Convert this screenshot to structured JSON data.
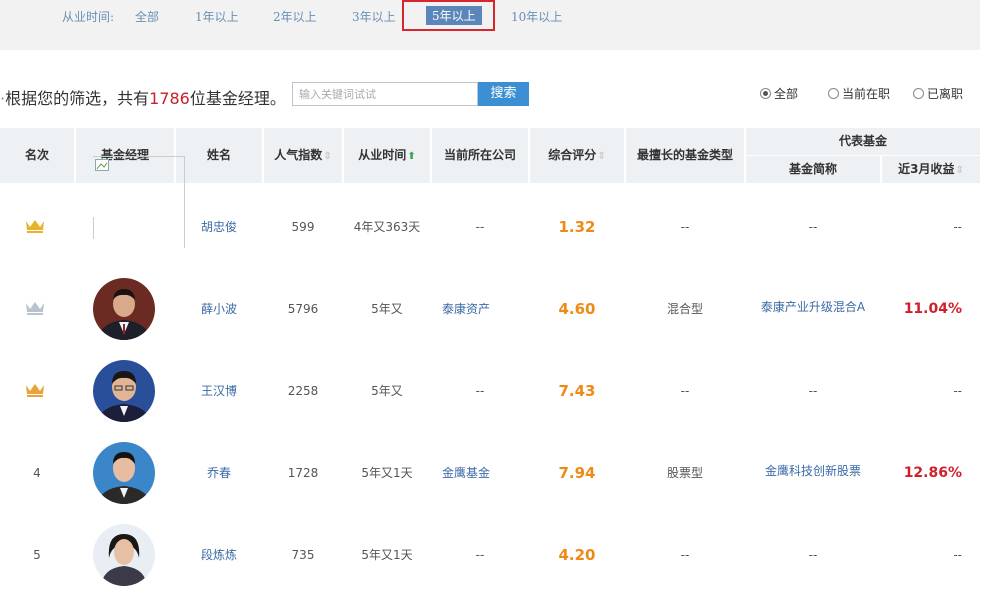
{
  "filter": {
    "label": "从业时间:",
    "options": [
      "全部",
      "1年以上",
      "2年以上",
      "3年以上",
      "5年以上",
      "10年以上"
    ],
    "selected": "5年以上"
  },
  "search": {
    "summary_prefix": "根据您的筛选，共有",
    "count": "1786",
    "summary_suffix": "位基金经理。",
    "placeholder": "输入关键词试试",
    "button": "搜索",
    "radios": [
      "全部",
      "当前在职",
      "已离职"
    ],
    "radio_selected": "全部"
  },
  "table": {
    "headers": {
      "rank": "名次",
      "manager": "基金经理",
      "name": "姓名",
      "popularity": "人气指数",
      "tenure": "从业时间",
      "company": "当前所在公司",
      "score": "综合评分",
      "best_type": "最擅长的基金类型",
      "rep_fund": "代表基金",
      "fund_short": "基金简称",
      "return_3m": "近3月收益"
    },
    "rows": [
      {
        "rank": "",
        "rank_icon": "gold-crown-icon",
        "name": "胡忠俊",
        "popularity": "599",
        "tenure": "4年又363天",
        "company": "--",
        "score": "1.32",
        "best_type": "--",
        "fund": "--",
        "ret": "--"
      },
      {
        "rank": "",
        "rank_icon": "silver-crown-icon",
        "name": "薛小波",
        "popularity": "5796",
        "tenure": "5年又",
        "company": "泰康资产",
        "score": "4.60",
        "best_type": "混合型",
        "fund": "泰康产业升级混合A",
        "ret": "11.04%"
      },
      {
        "rank": "",
        "rank_icon": "bronze-crown-icon",
        "name": "王汉博",
        "popularity": "2258",
        "tenure": "5年又",
        "company": "--",
        "score": "7.43",
        "best_type": "--",
        "fund": "--",
        "ret": "--"
      },
      {
        "rank": "4",
        "rank_icon": "",
        "name": "乔春",
        "popularity": "1728",
        "tenure": "5年又1天",
        "company": "金鹰基金",
        "score": "7.94",
        "best_type": "股票型",
        "fund": "金鹰科技创新股票",
        "ret": "12.86%"
      },
      {
        "rank": "5",
        "rank_icon": "",
        "name": "段炼炼",
        "popularity": "735",
        "tenure": "5年又1天",
        "company": "--",
        "score": "4.20",
        "best_type": "--",
        "fund": "--",
        "ret": "--"
      }
    ]
  },
  "colors": {
    "accent_blue": "#3d8fd4",
    "score_orange": "#f08a16",
    "return_red": "#d0202a",
    "link_blue": "#3b6aa6",
    "highlight_red": "#d8262e",
    "gold": "#e8b22a",
    "silver": "#b9c3d0"
  }
}
